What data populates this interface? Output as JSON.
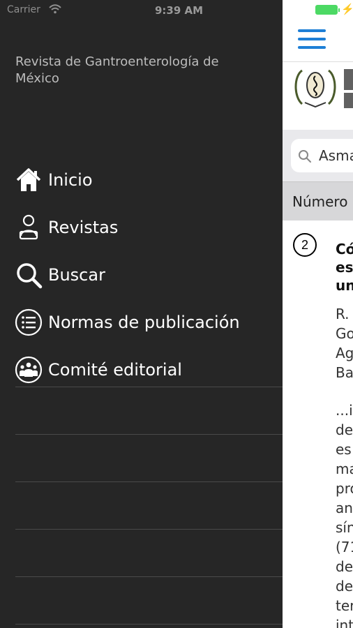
{
  "status_bar": {
    "carrier": "Carrier",
    "time": "9:39 AM"
  },
  "drawer": {
    "journal_title": "Revista de Gantroenterología de México",
    "menu": [
      {
        "label": "Inicio",
        "icon": "home-icon"
      },
      {
        "label": "Revistas",
        "icon": "reader-icon"
      },
      {
        "label": "Buscar",
        "icon": "search-icon"
      },
      {
        "label": "Normas de publicación",
        "icon": "list-icon"
      },
      {
        "label": "Comité editorial",
        "icon": "group-icon"
      }
    ]
  },
  "main": {
    "search_value": "Asma",
    "filter_label": "Número",
    "result": {
      "number": "2",
      "title_lines": [
        "Có",
        "es",
        "un"
      ],
      "author_lines": [
        "R.",
        "Go",
        "Ag",
        "Ba"
      ],
      "snippet_lines": [
        "...i",
        "de",
        "es",
        "ma",
        "pro",
        "an",
        "sín",
        "(71",
        "de",
        "de",
        "ter",
        "int"
      ]
    }
  },
  "colors": {
    "accent": "#1e7fd6",
    "drawer_bg": "#262626",
    "battery": "#4cd964"
  }
}
